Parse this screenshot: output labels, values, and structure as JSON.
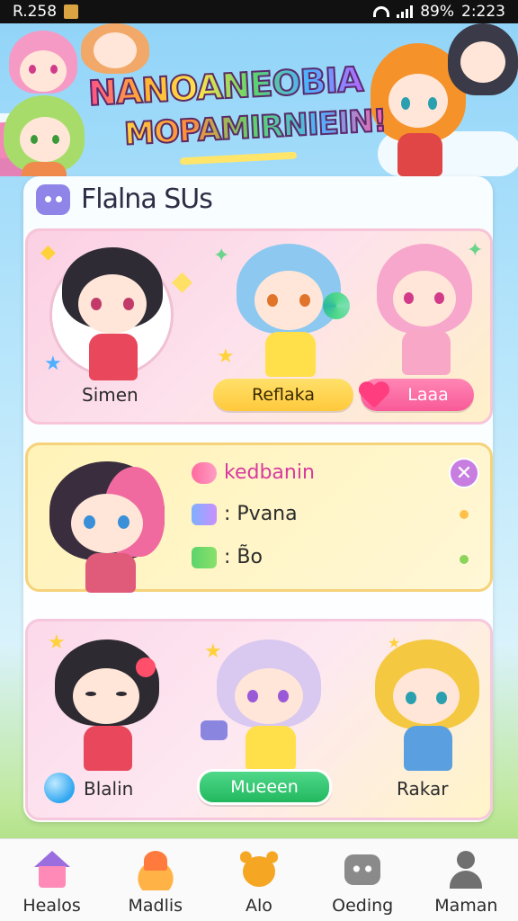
{
  "status_bar": {
    "left_text": "R.258",
    "battery": "89%",
    "time": "2:223"
  },
  "header": {
    "logo_line_1": "NANOANEOBIA",
    "logo_line_2": "MOPAMIRNIEIN!"
  },
  "card": {
    "title": "Flalna SUs",
    "panel_1": {
      "names": [
        "Simen",
        "Reflaka",
        "Laaa"
      ]
    },
    "panel_2": {
      "rows": [
        {
          "icon": "candy-icon",
          "text": "kedbanin",
          "color": "#d83aa0"
        },
        {
          "icon": "tag-icon",
          "text": ": Pvana",
          "color": "#2b2b2b"
        },
        {
          "icon": "gift-icon",
          "text": ": B̃o",
          "color": "#2b2b2b"
        }
      ],
      "close_glyph": "✕"
    },
    "panel_3": {
      "names": [
        "Blalin",
        "Mueeen",
        "Rakar"
      ]
    }
  },
  "bottom_nav": {
    "items": [
      {
        "label": "Healos",
        "icon": "home-icon"
      },
      {
        "label": "Madlis",
        "icon": "food-icon"
      },
      {
        "label": "Alo",
        "icon": "bear-icon"
      },
      {
        "label": "Oeding",
        "icon": "cat-icon"
      },
      {
        "label": "Maman",
        "icon": "user-icon"
      }
    ]
  },
  "colors": {
    "accent_pink": "#f85a98",
    "accent_yellow": "#ffc93c",
    "accent_green": "#22b85f",
    "accent_purple": "#8f84e8"
  }
}
